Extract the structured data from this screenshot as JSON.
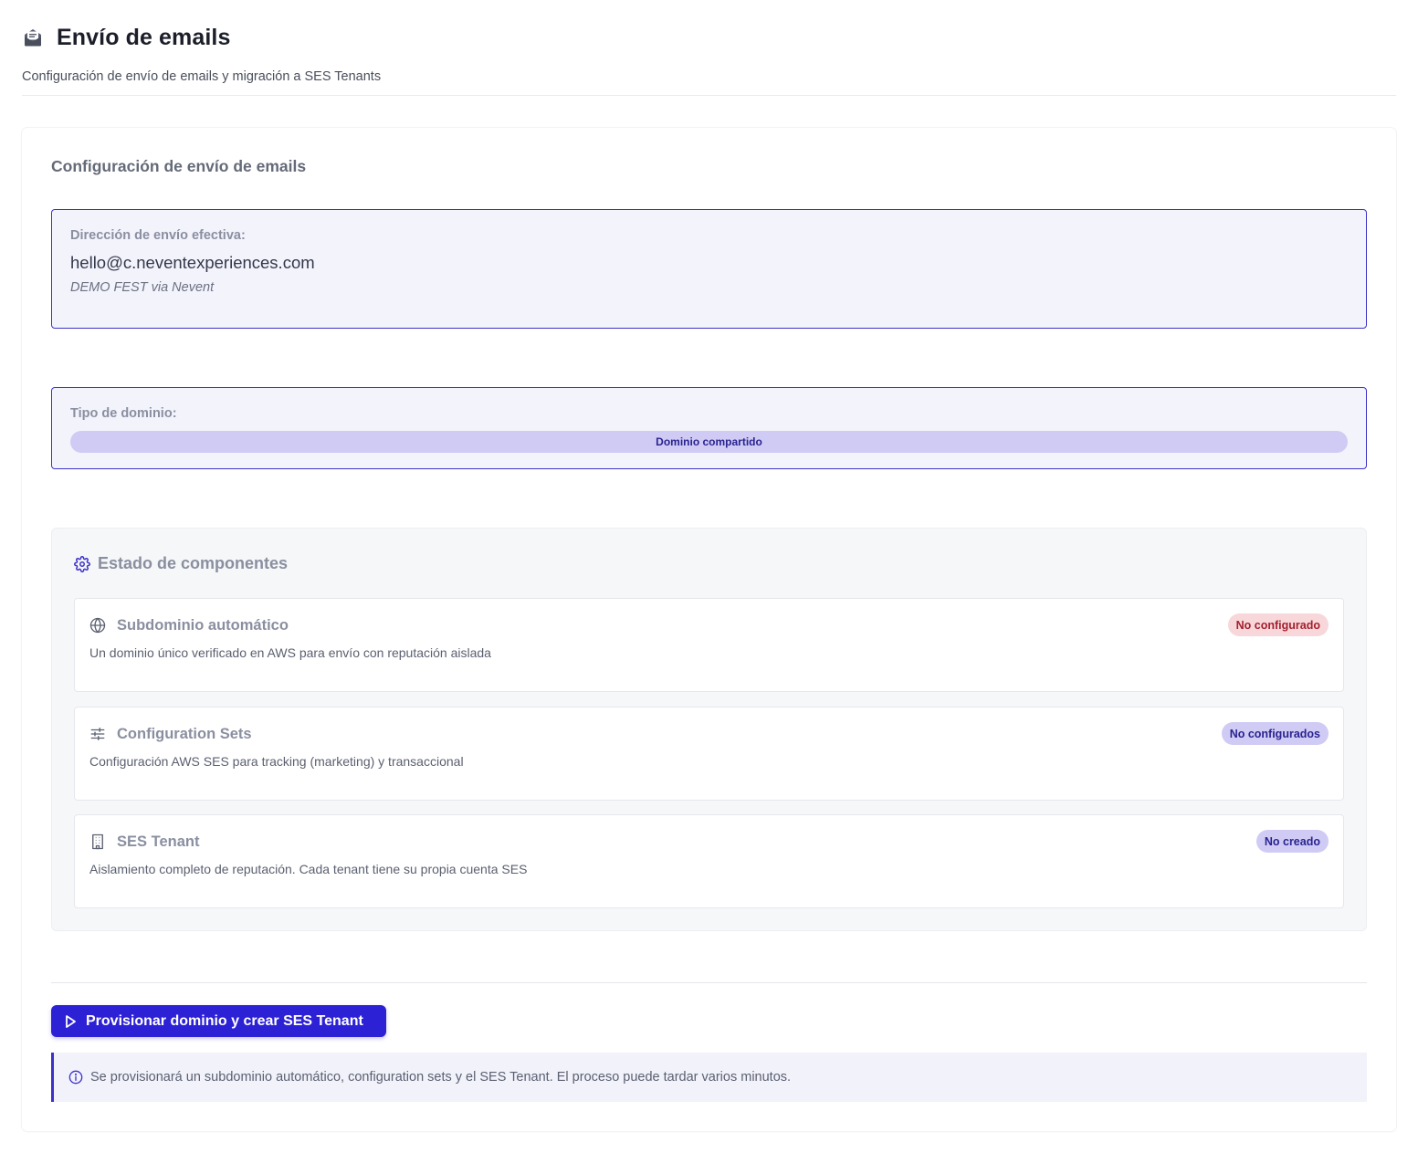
{
  "header": {
    "title": "Envío de emails",
    "subtitle": "Configuración de envío de emails y migración a SES Tenants",
    "icon": "envelope-open-icon"
  },
  "config": {
    "section_title": "Configuración de envío de emails",
    "effective_address": {
      "label": "Dirección de envío efectiva:",
      "email": "hello@c.neventexperiences.com",
      "sender_name": "DEMO FEST via Nevent"
    },
    "domain_type": {
      "label": "Tipo de dominio:",
      "value": "Dominio compartido"
    }
  },
  "components": {
    "title": "Estado de componentes",
    "icon": "gear-icon",
    "items": [
      {
        "name": "Subdominio automático",
        "description": "Un dominio único verificado en AWS para envío con reputación aislada",
        "status": "No configurado",
        "icon": "globe-icon",
        "status_color": "#f8d7da",
        "status_text_color": "#a3202e"
      },
      {
        "name": "Configuration Sets",
        "description": "Configuración AWS SES para tracking (marketing) y transaccional",
        "status": "No configurados",
        "icon": "sliders-icon",
        "status_color": "#cfcbf4",
        "status_text_color": "#2a2390"
      },
      {
        "name": "SES Tenant",
        "description": "Aislamiento completo de reputación. Cada tenant tiene su propia cuenta SES",
        "status": "No creado",
        "icon": "building-icon",
        "status_color": "#cfcbf4",
        "status_text_color": "#2a2390"
      }
    ]
  },
  "action": {
    "button_label": "Provisionar dominio y crear SES Tenant",
    "button_icon": "play-icon",
    "info_icon": "info-icon",
    "info_text": "Se provisionará un subdominio automático, configuration sets y el SES Tenant. El proceso puede tardar varios minutos."
  },
  "colors": {
    "accent": "#2d21d6",
    "border_accent": "#3d32c9",
    "box_bg": "#f3f3fc"
  }
}
